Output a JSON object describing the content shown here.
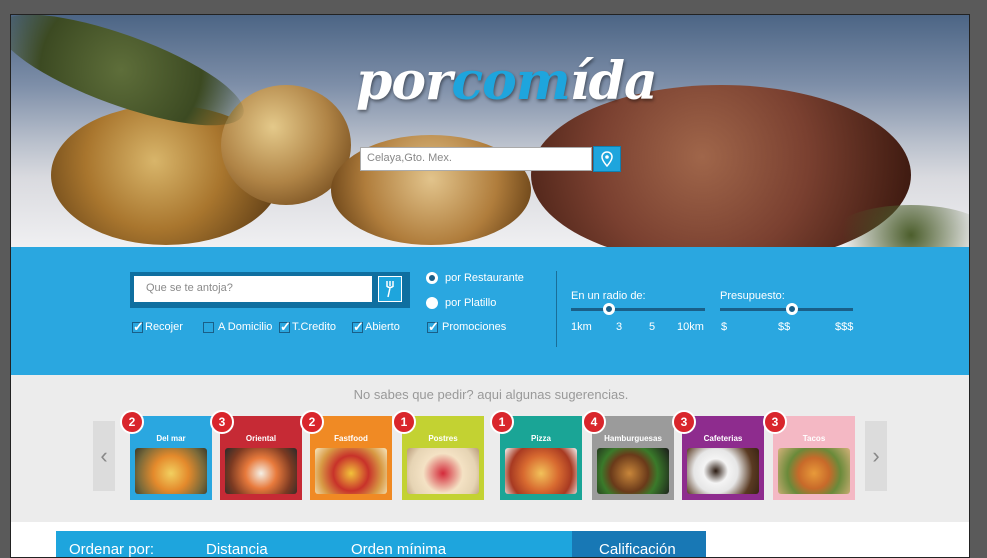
{
  "hero": {
    "logo_part1": "por",
    "logo_part2": "com",
    "logo_part3": "ída",
    "location_placeholder": "Celaya,Gto. Mex."
  },
  "filters": {
    "search_placeholder": "Que se te antoja?",
    "checkboxes": [
      {
        "label": "Recojer",
        "checked": true
      },
      {
        "label": "A Domicilio",
        "checked": false
      },
      {
        "label": "T.Credito",
        "checked": true
      },
      {
        "label": "Abierto",
        "checked": true
      },
      {
        "label": "Promociones",
        "checked": true
      }
    ],
    "radios": [
      {
        "label": "por Restaurante",
        "selected": true
      },
      {
        "label": "por Platillo",
        "selected": false
      }
    ],
    "radius": {
      "label": "En un radio de:",
      "ticks": [
        "1km",
        "3",
        "5",
        "10km"
      ],
      "value": "3"
    },
    "budget": {
      "label": "Presupuesto:",
      "ticks": [
        "$",
        "$$",
        "$$$"
      ],
      "value": "$$"
    }
  },
  "suggestions": {
    "title": "No sabes que pedir? aqui algunas sugerencias.",
    "categories": [
      {
        "name": "Del mar",
        "count": "2",
        "color": "#2aa7e0"
      },
      {
        "name": "Oriental",
        "count": "3",
        "color": "#c62a35"
      },
      {
        "name": "Fastfood",
        "count": "2",
        "color": "#f08a24"
      },
      {
        "name": "Postres",
        "count": "1",
        "color": "#c3d232"
      },
      {
        "name": "Pizza",
        "count": "1",
        "color": "#1aa596"
      },
      {
        "name": "Hamburguesas",
        "count": "4",
        "color": "#9b9b9b"
      },
      {
        "name": "Cafeterias",
        "count": "3",
        "color": "#8e2c8e"
      },
      {
        "name": "Tacos",
        "count": "3",
        "color": "#f4b8c4"
      }
    ]
  },
  "sort": {
    "label": "Ordenar por:",
    "options": [
      "Distancia",
      "Orden mínima",
      "Calificación"
    ],
    "active": "Calificación"
  }
}
